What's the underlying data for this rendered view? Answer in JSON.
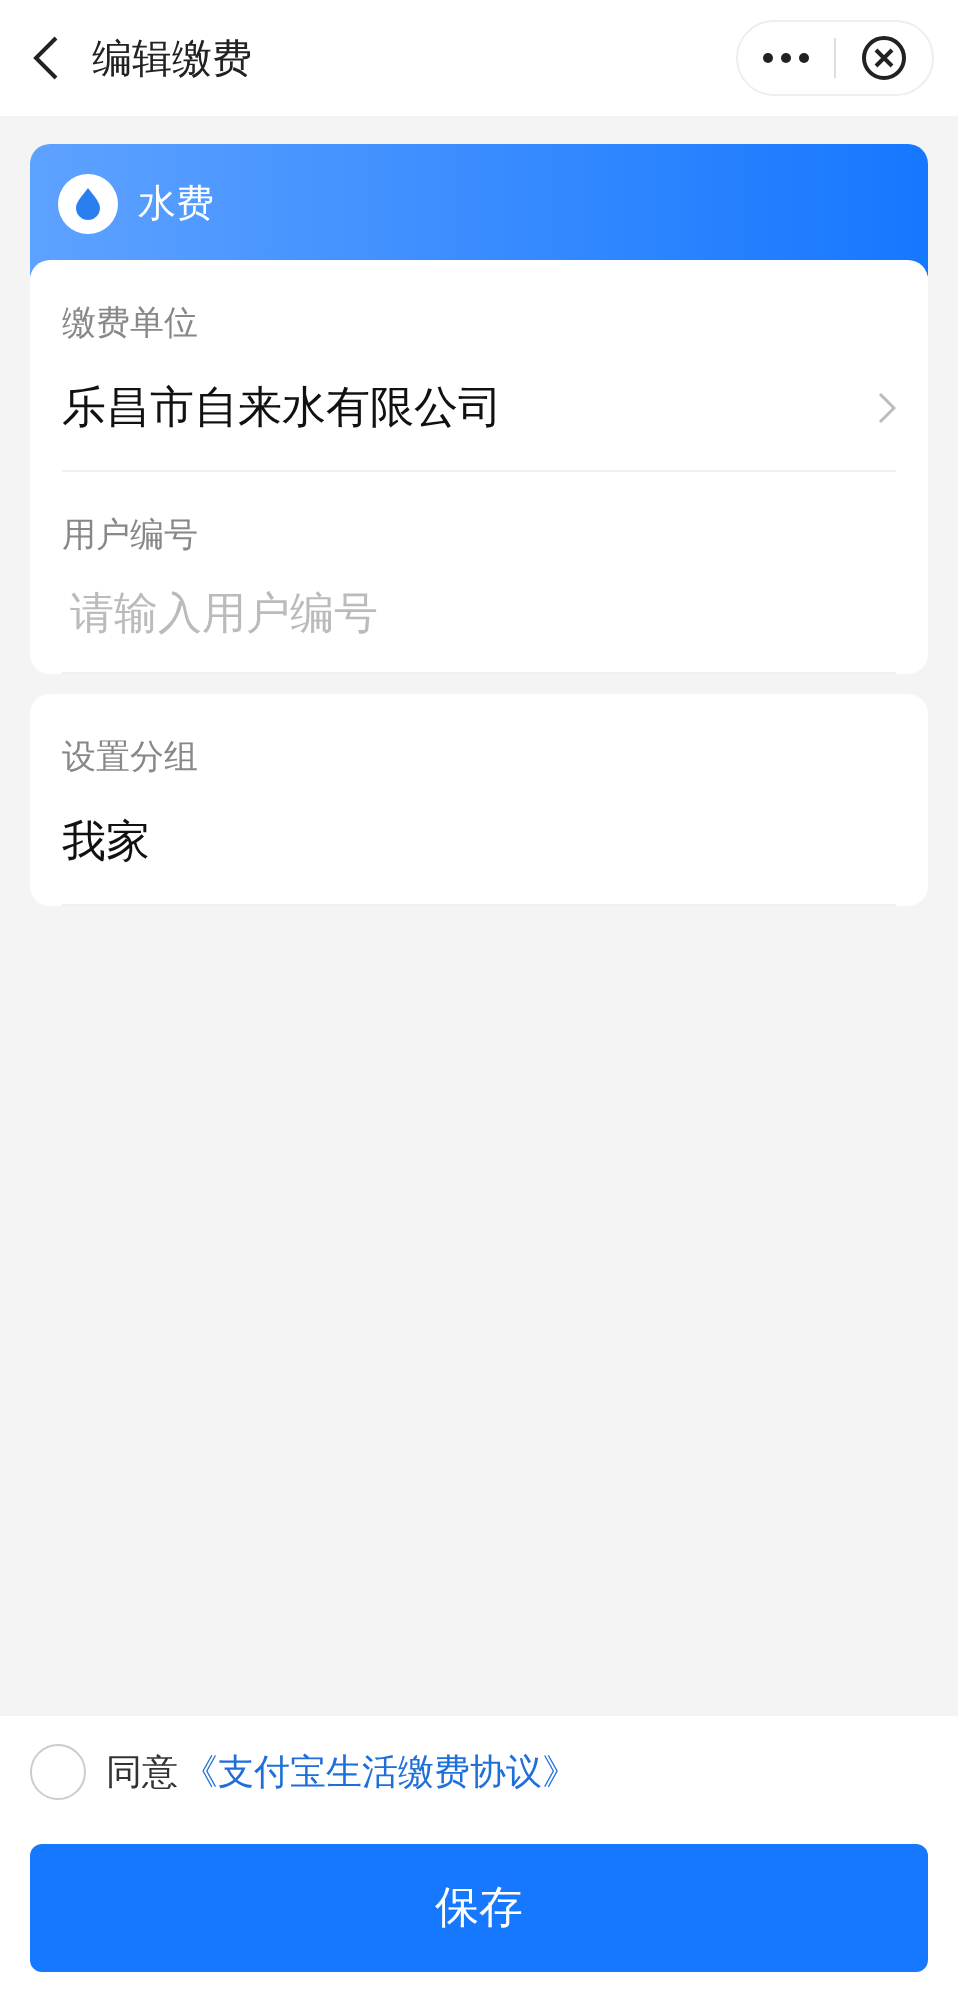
{
  "header": {
    "title": "编辑缴费"
  },
  "category": {
    "label": "水费"
  },
  "cards": [
    {
      "fields": [
        {
          "kind": "select",
          "label": "缴费单位",
          "value": "乐昌市自来水有限公司"
        },
        {
          "kind": "input",
          "label": "用户编号",
          "placeholder": "请输入用户编号"
        }
      ]
    },
    {
      "fields": [
        {
          "kind": "text",
          "label": "设置分组",
          "value": "我家"
        }
      ]
    }
  ],
  "agreement": {
    "checked": false,
    "prefix": "同意",
    "link": "《支付宝生活缴费协议》"
  },
  "save_button": {
    "label": "保存"
  }
}
